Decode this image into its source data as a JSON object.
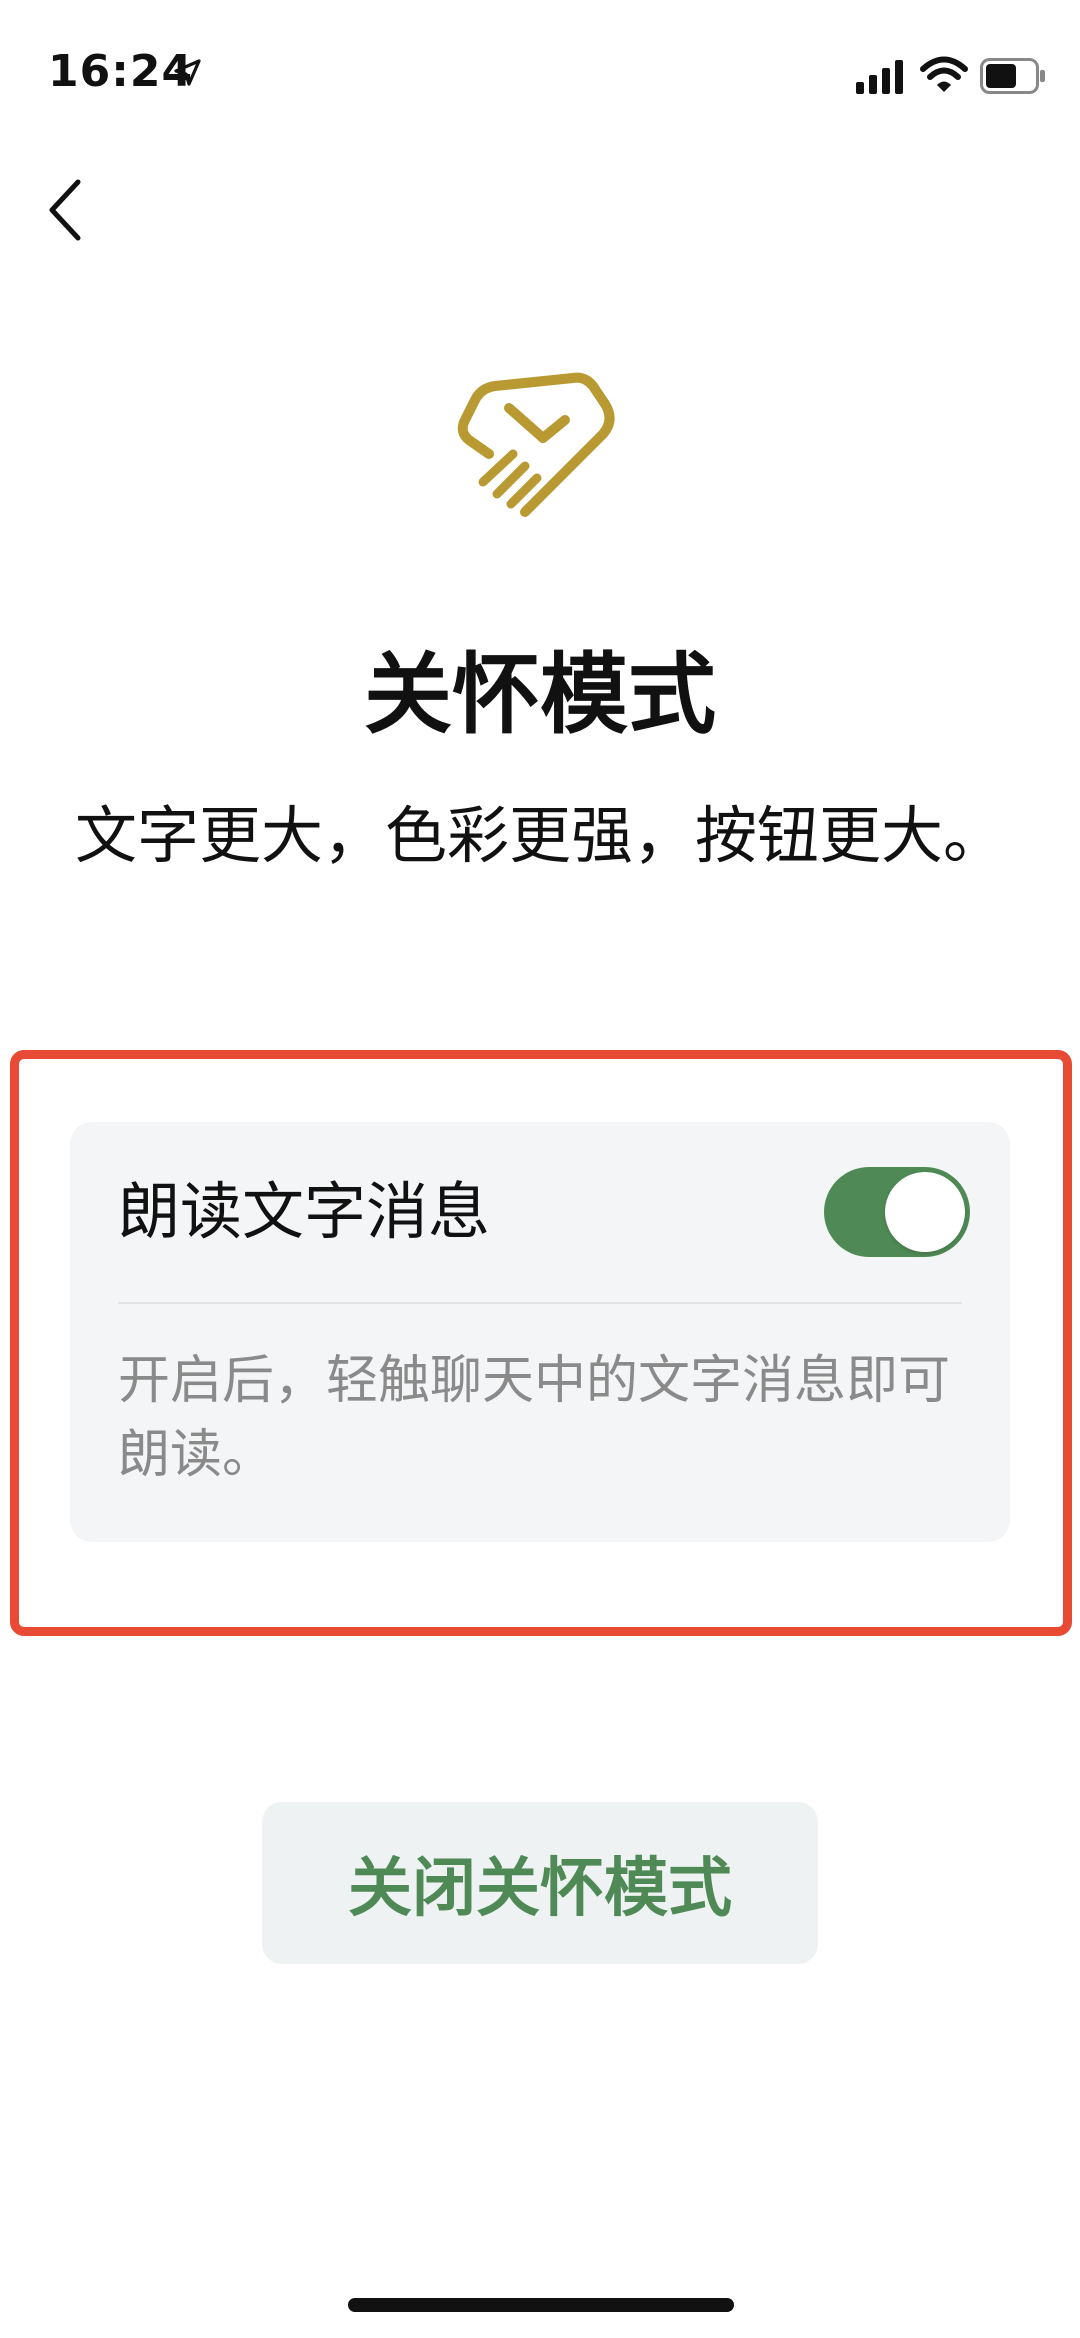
{
  "status_bar": {
    "time": "16:24",
    "icons": [
      "location-arrow-icon",
      "cellular-signal-icon",
      "wifi-icon",
      "battery-icon"
    ]
  },
  "navigation": {
    "back_icon": "chevron-left-icon"
  },
  "hero": {
    "logo_icon": "care-heart-hand-icon",
    "title": "关怀模式",
    "subtitle": "文字更大，色彩更强，按钮更大。"
  },
  "read_aloud_setting": {
    "label": "朗读文字消息",
    "enabled": true,
    "description": "开启后，轻触聊天中的文字消息即可朗读。"
  },
  "actions": {
    "exit_label": "关闭关怀模式"
  },
  "colors": {
    "accent_green": "#4f8a56",
    "logo_gold": "#b99a32",
    "highlight_red": "#e84a34",
    "card_background": "#f3f5f6",
    "description_gray": "#8a8a8a"
  }
}
